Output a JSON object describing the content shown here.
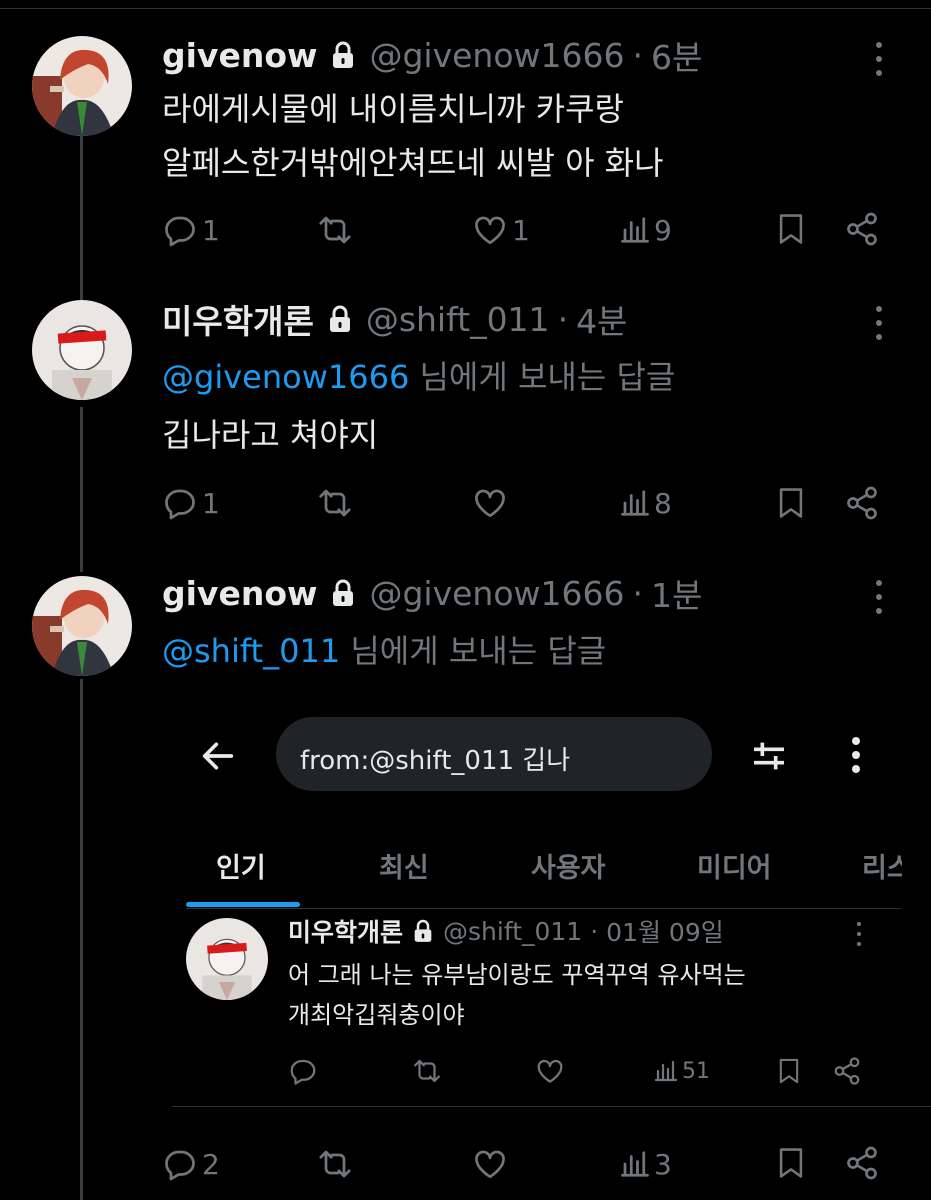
{
  "posts": [
    {
      "name": "givenow",
      "handle": "@givenow1666",
      "time": "6분",
      "lines": [
        "라에게시물에 내이름치니까 카쿠랑",
        "알페스한거밖에안쳐뜨네 씨발 아 화나"
      ],
      "replies": "1",
      "retweets": "",
      "likes": "1",
      "views": "9"
    },
    {
      "name": "미우학개론",
      "handle": "@shift_011",
      "time": "4분",
      "reply_to": "@givenow1666",
      "reply_suffix": " 님에게 보내는 답글",
      "lines": [
        "깁나라고 쳐야지"
      ],
      "replies": "1",
      "retweets": "",
      "likes": "",
      "views": "8"
    },
    {
      "name": "givenow",
      "handle": "@givenow1666",
      "time": "1분",
      "reply_to": "@shift_011",
      "reply_suffix": " 님에게 보내는 답글",
      "replies": "2",
      "retweets": "",
      "likes": "",
      "views": "3"
    }
  ],
  "embedded": {
    "search_query": "from:@shift_011 깁나",
    "tabs": [
      "인기",
      "최신",
      "사용자",
      "미디어",
      "리스"
    ],
    "active_tab": "인기",
    "result": {
      "name": "미우학개론",
      "handle": "@shift_011",
      "date": "01월 09일",
      "lines": [
        "어 그래 나는 유부남이랑도 꾸역꾸역 유사먹는",
        "개최악깁줘충이야"
      ],
      "views": "51"
    }
  },
  "separator": "·",
  "colors": {
    "accent": "#1d9bf0",
    "muted": "#71767b",
    "text": "#e7e9ea",
    "background": "#000000"
  },
  "icons": [
    "lock-icon",
    "more-icon",
    "reply-icon",
    "retweet-icon",
    "like-icon",
    "views-icon",
    "bookmark-icon",
    "share-icon",
    "back-arrow-icon",
    "filter-icon"
  ]
}
